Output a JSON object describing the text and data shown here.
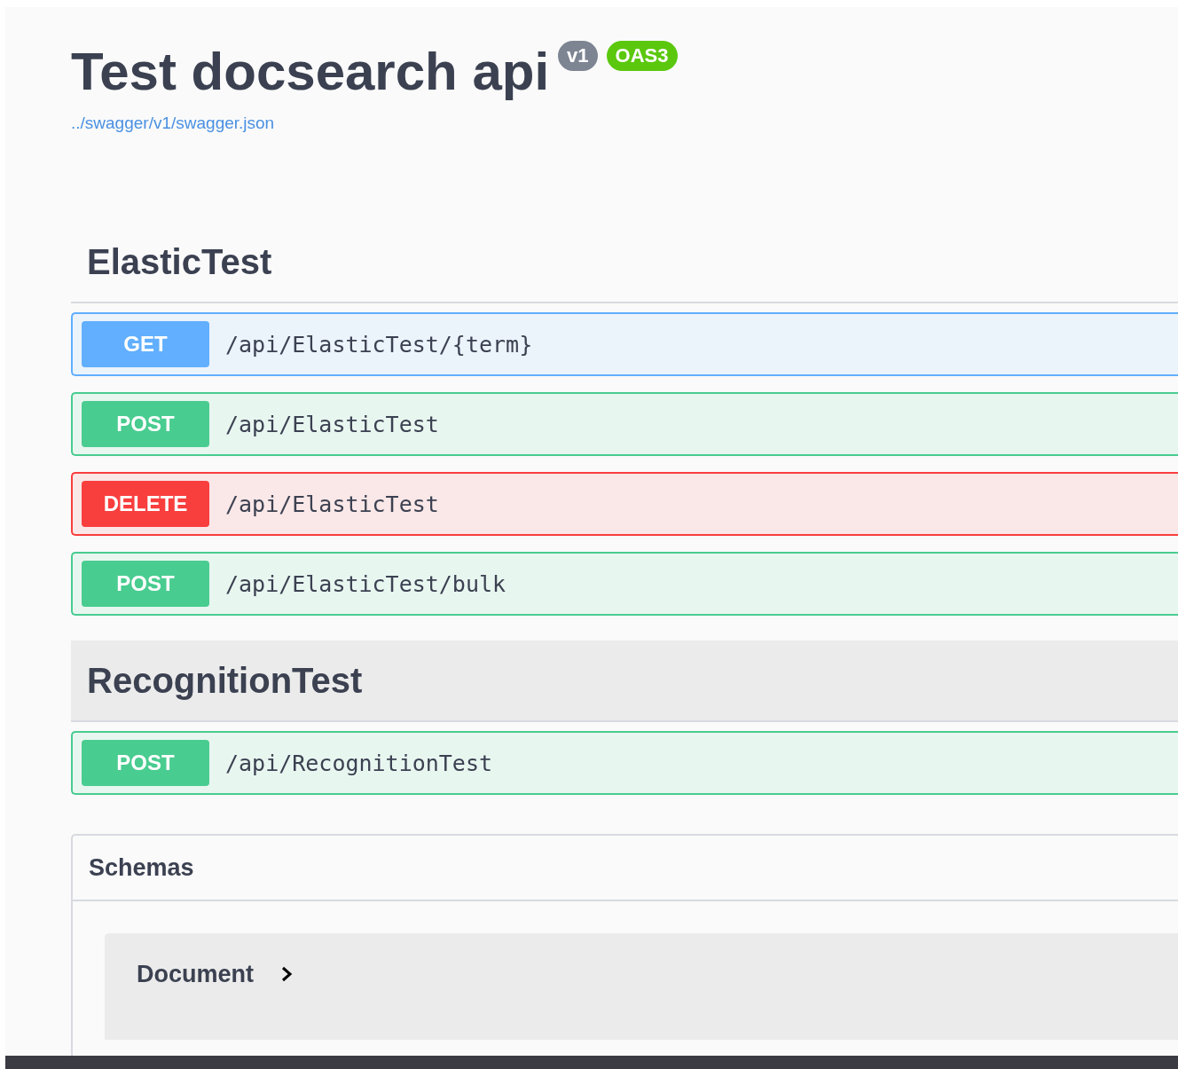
{
  "info": {
    "title": "Test docsearch api",
    "version": "v1",
    "spec": "OAS3",
    "url": "../swagger/v1/swagger.json"
  },
  "tags": [
    {
      "name": "ElasticTest",
      "highlighted": false,
      "operations": [
        {
          "kind": "get",
          "method": "GET",
          "path": "/api/ElasticTest/{term}"
        },
        {
          "kind": "post",
          "method": "POST",
          "path": "/api/ElasticTest"
        },
        {
          "kind": "delete",
          "method": "DELETE",
          "path": "/api/ElasticTest"
        },
        {
          "kind": "post",
          "method": "POST",
          "path": "/api/ElasticTest/bulk"
        }
      ]
    },
    {
      "name": "RecognitionTest",
      "highlighted": true,
      "operations": [
        {
          "kind": "post",
          "method": "POST",
          "path": "/api/RecognitionTest"
        }
      ]
    }
  ],
  "schemas": {
    "title": "Schemas",
    "models": [
      {
        "name": "Document",
        "expanded": false
      }
    ]
  }
}
